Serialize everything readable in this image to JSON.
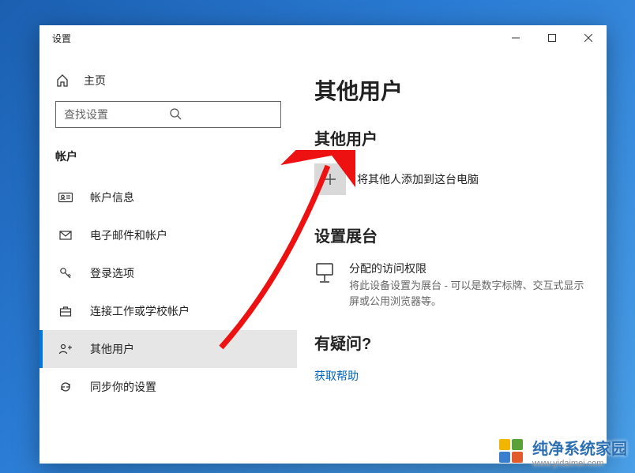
{
  "window": {
    "title": "设置"
  },
  "sidebar": {
    "home": "主页",
    "search_placeholder": "查找设置",
    "section": "帐户",
    "items": [
      {
        "label": "帐户信息"
      },
      {
        "label": "电子邮件和帐户"
      },
      {
        "label": "登录选项"
      },
      {
        "label": "连接工作或学校帐户"
      },
      {
        "label": "其他用户"
      },
      {
        "label": "同步你的设置"
      }
    ]
  },
  "content": {
    "page_title": "其他用户",
    "other_users_heading": "其他用户",
    "add_label": "将其他人添加到这台电脑",
    "kiosk_heading": "设置展台",
    "kiosk_title": "分配的访问权限",
    "kiosk_desc": "将此设备设置为展台 - 可以是数字标牌、交互式显示屏或公用浏览器等。",
    "help_heading": "有疑问?",
    "help_link": "获取帮助"
  },
  "watermark": {
    "text": "纯净系统家园",
    "url": "www.yidaimei.com"
  }
}
